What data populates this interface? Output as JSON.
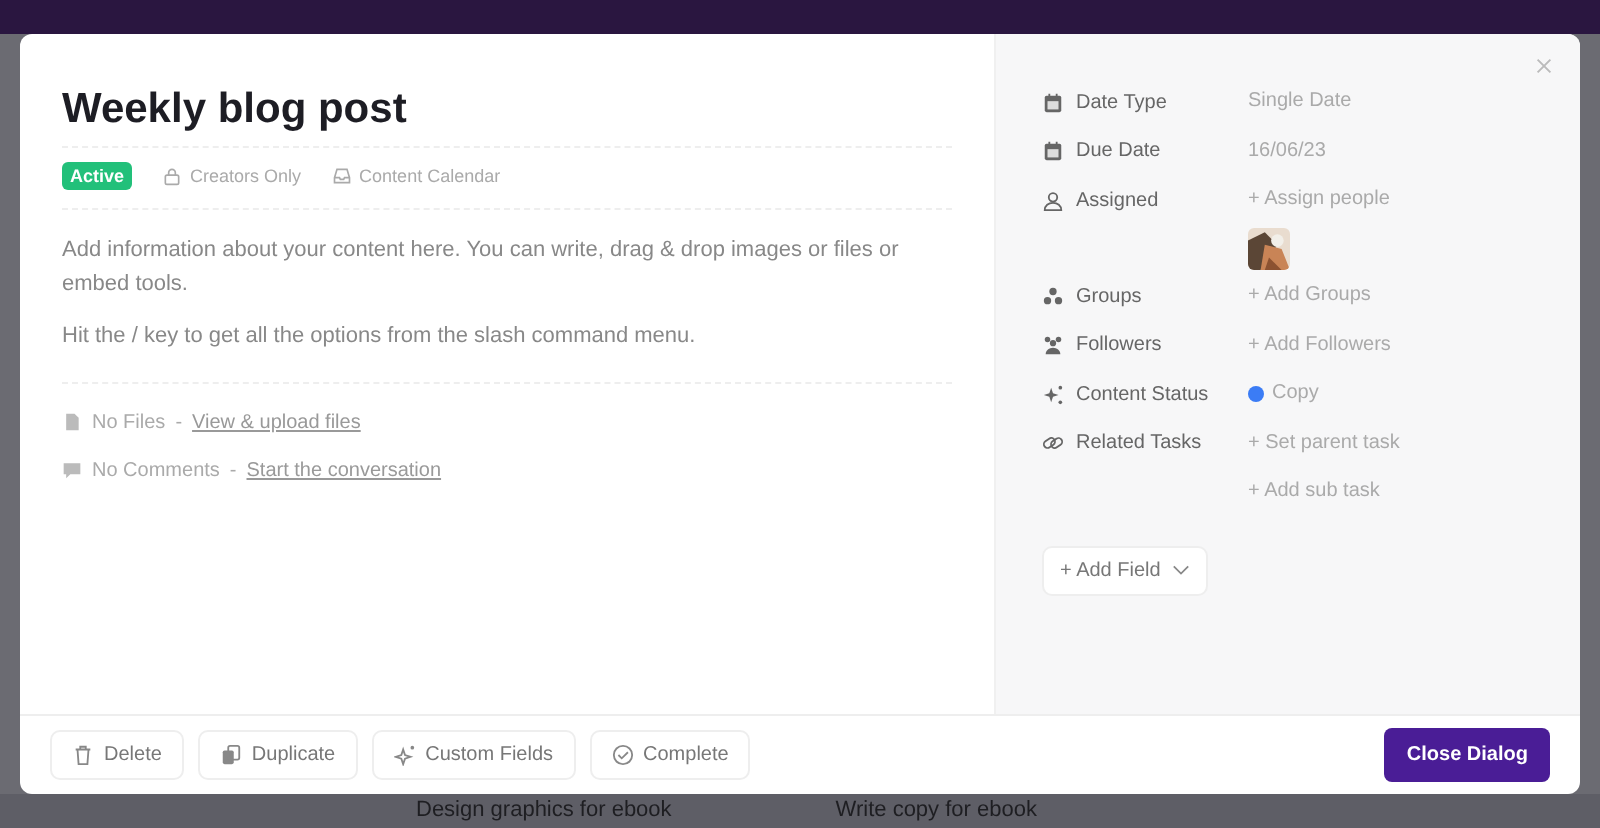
{
  "background": {
    "cards": [
      "Design graphics for ebook",
      "Write copy for ebook"
    ]
  },
  "task": {
    "title": "Weekly blog post",
    "status": {
      "label": "Active",
      "color": "#22c07a"
    },
    "visibility": "Creators Only",
    "calendar": "Content Calendar",
    "description": [
      "Add information about your content here. You can write, drag & drop images or files or embed tools.",
      "Hit the / key to get all the options from the slash command menu."
    ],
    "attachments": [
      {
        "kind": "file",
        "label": "No Files",
        "separator": "-",
        "link": "View & upload files"
      },
      {
        "kind": "comment",
        "label": "No Comments",
        "separator": "-",
        "link": "Start the conversation"
      }
    ]
  },
  "fields": [
    {
      "kind": "calendar",
      "label": "Date Type",
      "values": [
        {
          "kind": "text",
          "text": "Single Date"
        }
      ]
    },
    {
      "kind": "calendar",
      "label": "Due Date",
      "values": [
        {
          "kind": "text",
          "text": "16/06/23"
        }
      ]
    },
    {
      "kind": "person",
      "label": "Assigned",
      "values": [
        {
          "kind": "action",
          "text": "+ Assign people"
        },
        {
          "kind": "picture"
        }
      ]
    },
    {
      "kind": "groups",
      "label": "Groups",
      "values": [
        {
          "kind": "action",
          "text": "+ Add Groups"
        }
      ]
    },
    {
      "kind": "followers",
      "label": "Followers",
      "values": [
        {
          "kind": "action",
          "text": "+ Add Followers"
        }
      ]
    },
    {
      "kind": "status",
      "label": "Content Status",
      "values": [
        {
          "kind": "status",
          "text": "Copy",
          "color": "#3b7cf5"
        }
      ]
    },
    {
      "kind": "relations",
      "label": "Related Tasks",
      "values": [
        {
          "kind": "action",
          "text": "+ Set parent task"
        },
        {
          "kind": "action",
          "text": "+ Add sub task"
        }
      ]
    }
  ],
  "add_field": "+ Add Field",
  "footer": {
    "buttons": [
      {
        "kind": "delete",
        "label": "Delete"
      },
      {
        "kind": "duplicate",
        "label": "Duplicate"
      },
      {
        "kind": "custom",
        "label": "Custom Fields"
      },
      {
        "kind": "complete",
        "label": "Complete"
      }
    ],
    "primary": "Close Dialog"
  }
}
